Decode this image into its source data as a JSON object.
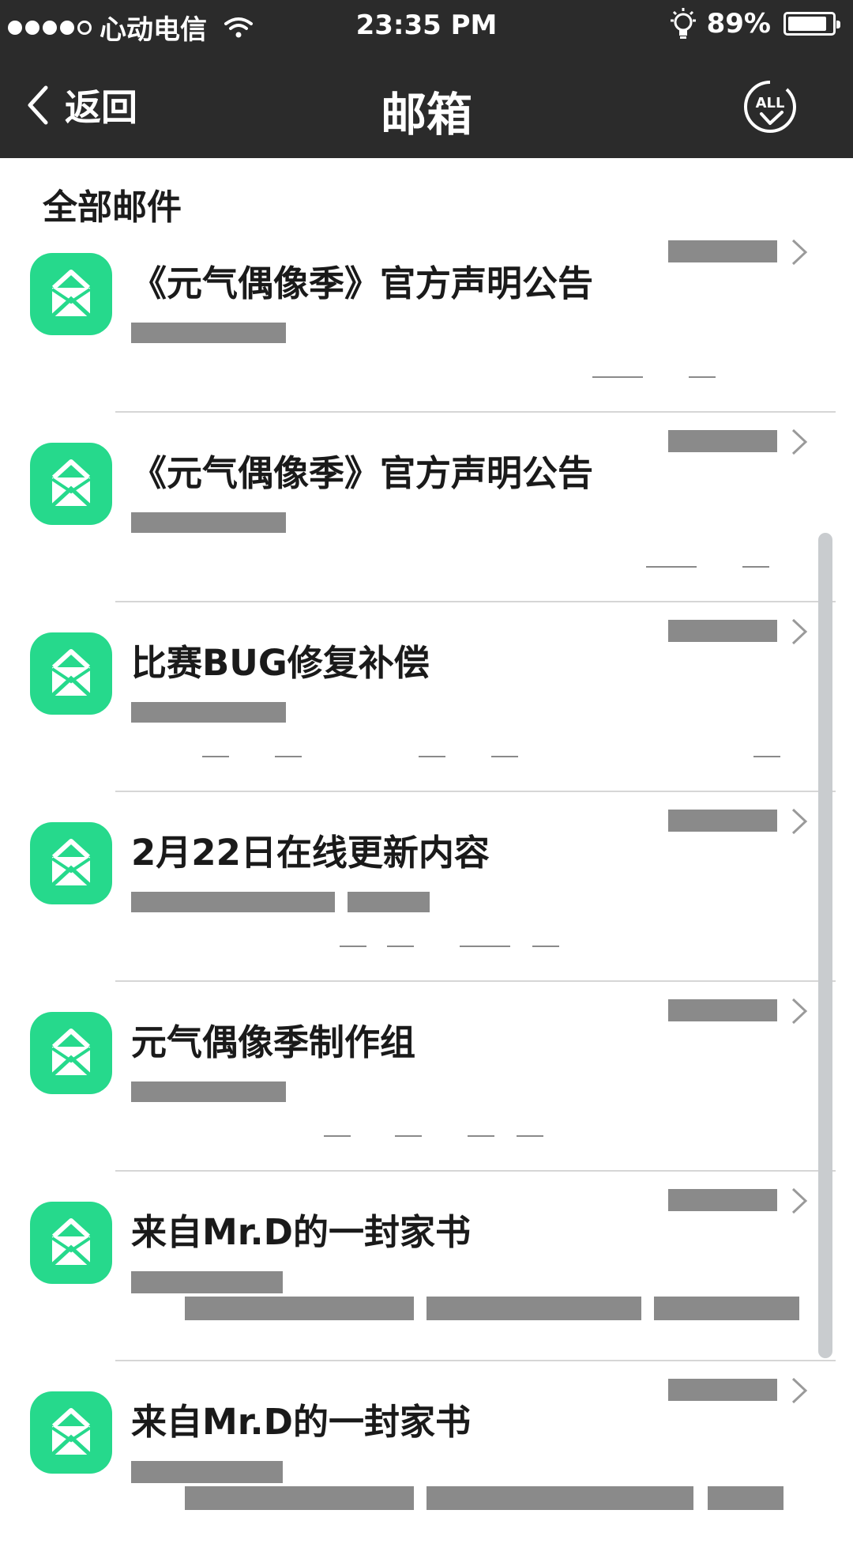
{
  "status_bar": {
    "carrier": "心动电信",
    "time": "23:35 PM",
    "battery": "89%",
    "battery_level": 0.89,
    "signal_bars_filled": 4,
    "signal_bars_total": 5
  },
  "nav": {
    "back_label": "返回",
    "title": "邮箱",
    "all_label": "ALL"
  },
  "section_title": "全部邮件",
  "accent_color": "#26d98c",
  "mails": [
    {
      "title": "《元气偶像季》官方声明公告"
    },
    {
      "title": "《元气偶像季》官方声明公告"
    },
    {
      "title": "比赛BUG修复补偿"
    },
    {
      "title": "2月22日在线更新内容"
    },
    {
      "title": "元气偶像季制作组"
    },
    {
      "title": "来自Mr.D的一封家书"
    },
    {
      "title": "来自Mr.D的一封家书"
    }
  ]
}
